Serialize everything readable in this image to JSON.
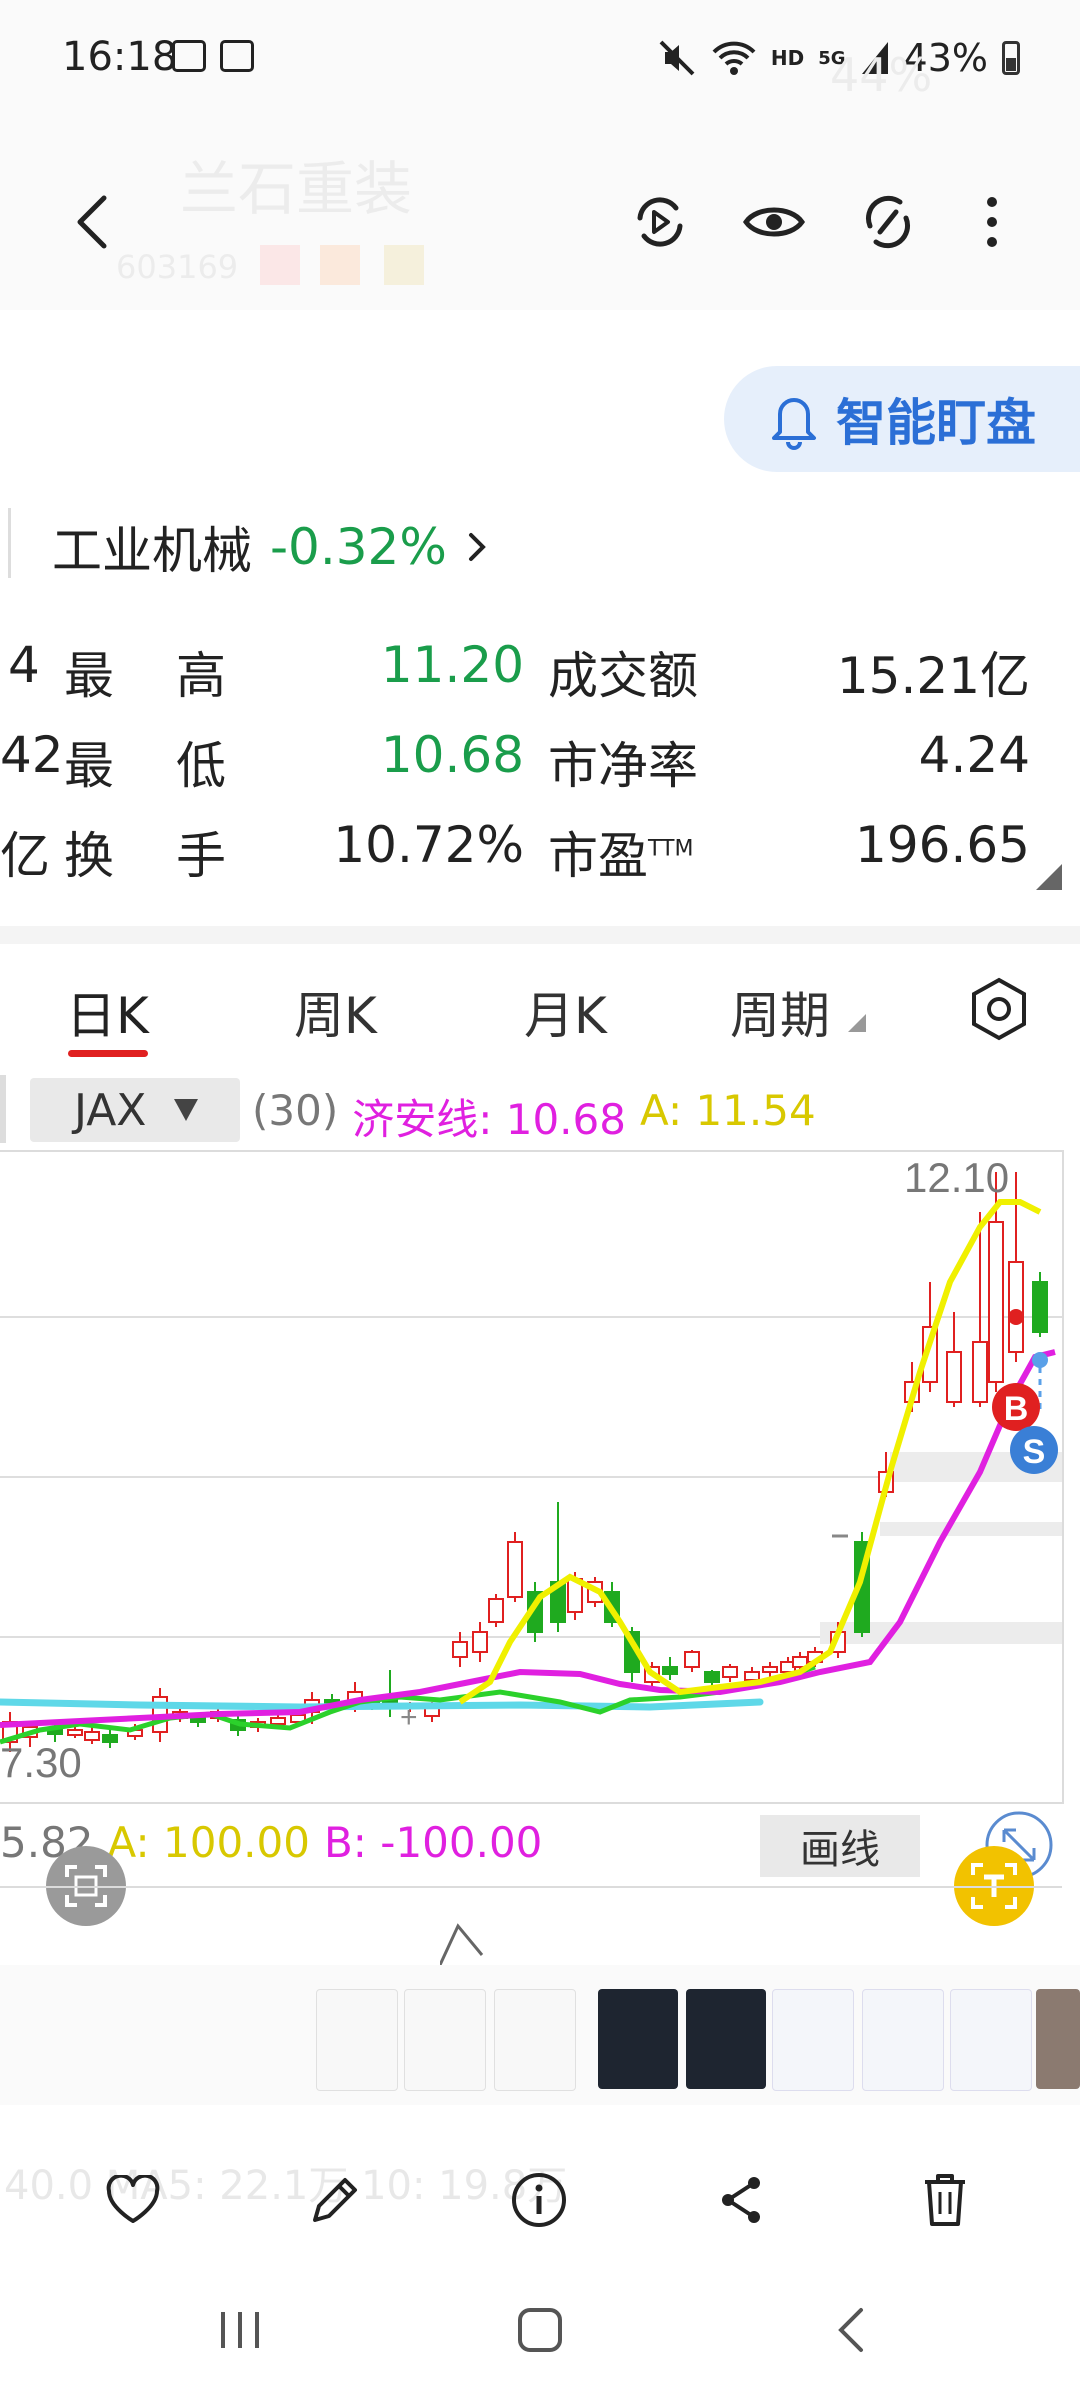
{
  "status_bar": {
    "time": "16:18",
    "wifi_tag": "HD",
    "signal_tag": "5G",
    "battery": "43%"
  },
  "background_header": {
    "stock_name": "兰石重装",
    "stock_code": "603169",
    "battery_ghost": "44%"
  },
  "smart_watch_button": {
    "label": "智能盯盘"
  },
  "industry": {
    "name": "工业机械",
    "change": "-0.32%"
  },
  "quote_rows": [
    {
      "left_partial": "4",
      "label_a": "最",
      "label_b": "高",
      "value": "11.20",
      "value_color": "green",
      "label2": "成交额",
      "value2": "15.21亿"
    },
    {
      "left_partial": "42",
      "label_a": "最",
      "label_b": "低",
      "value": "10.68",
      "value_color": "green",
      "label2": "市净率",
      "value2": "4.24"
    },
    {
      "left_partial": "亿",
      "label_a": "换",
      "label_b": "手",
      "value": "10.72%",
      "value_color": "dark",
      "label2": "市盈",
      "label2_sup": "TTM",
      "value2": "196.65"
    }
  ],
  "kline_tabs": [
    {
      "label": "日K",
      "active": true
    },
    {
      "label": "周K",
      "active": false
    },
    {
      "label": "月K",
      "active": false
    },
    {
      "label": "周期",
      "active": false
    }
  ],
  "indicator": {
    "selected": "JAX",
    "param": "(30)",
    "jax_label": "济安线: 10.68",
    "a_label": "A: 11.54",
    "jax_color": "#e020e0",
    "a_color": "#d8c800"
  },
  "chart_data": {
    "type": "candlestick",
    "high_label": "12.10",
    "low_label_partial": "7.30",
    "lines": [
      {
        "name": "济安线",
        "color": "#e020e0"
      },
      {
        "name": "A",
        "color": "#f0f000"
      }
    ],
    "markers": [
      "B",
      "S"
    ]
  },
  "sub_indicator": {
    "left_partial": "5.82",
    "a_label": "A: 100.00",
    "b_label": "B: -100.00",
    "draw_line_button": "画线"
  },
  "viewer": {
    "faded_volume_text": "40.0 MA5: 22.1万 10: 19.8万"
  },
  "colors": {
    "up": "#e02020",
    "down": "#1faa1f",
    "accent_tab": "#e02020",
    "smart_btn_bg": "#e6effb",
    "smart_btn_text": "#2b6fd6"
  }
}
